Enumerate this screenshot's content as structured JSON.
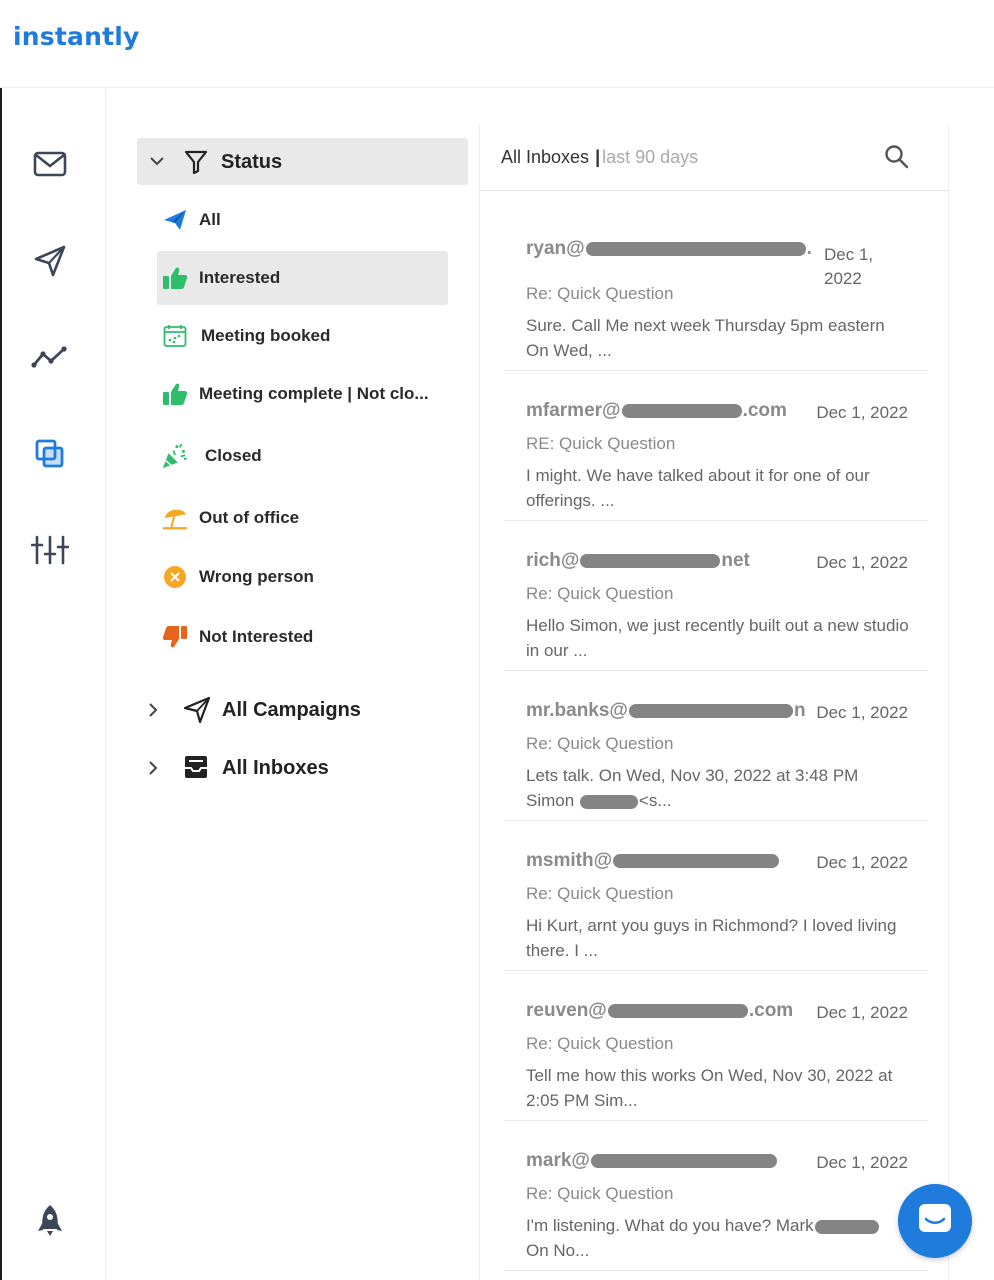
{
  "app": {
    "logo": "instantly",
    "brand_color": "#1f7bdc"
  },
  "rail": {
    "icons": [
      "mail-icon",
      "send-icon",
      "analytics-icon",
      "copy-layers-icon",
      "sliders-icon",
      "rocket-icon"
    ]
  },
  "filters": {
    "status_header": "Status",
    "statuses": [
      {
        "label": "All",
        "icon": "paper-plane-icon"
      },
      {
        "label": "Interested",
        "icon": "thumbs-up-icon",
        "active": true
      },
      {
        "label": "Meeting booked",
        "icon": "calendar-icon"
      },
      {
        "label": "Meeting complete | Not clo...",
        "icon": "thumbs-up-icon"
      },
      {
        "label": "Closed",
        "icon": "party-popper-icon"
      },
      {
        "label": "Out of office",
        "icon": "beach-umbrella-icon"
      },
      {
        "label": "Wrong person",
        "icon": "x-circle-icon"
      },
      {
        "label": "Not Interested",
        "icon": "thumbs-down-icon"
      }
    ],
    "groups": [
      {
        "label": "All Campaigns",
        "icon": "send-icon"
      },
      {
        "label": "All Inboxes",
        "icon": "inbox-icon"
      }
    ]
  },
  "inbox": {
    "header_label": "All Inboxes",
    "header_separator": "|",
    "header_range": "last 90 days",
    "emails": [
      {
        "sender_prefix": "ryan@",
        "sender_suffix": ".",
        "date": "Dec 1, 2022",
        "subject": "Re: Quick Question",
        "preview": "Sure. Call Me next week Thursday 5pm eastern On Wed, ..."
      },
      {
        "sender_prefix": "mfarmer@",
        "sender_suffix": ".com",
        "date": "Dec 1, 2022",
        "subject": "RE: Quick Question",
        "preview": "I might.  We have talked about it for one of our offerings. ..."
      },
      {
        "sender_prefix": "rich@",
        "sender_suffix": "net",
        "date": "Dec 1, 2022",
        "subject": "Re: Quick Question",
        "preview": "Hello Simon, we just recently built out a new studio in our ..."
      },
      {
        "sender_prefix": "mr.banks@",
        "sender_suffix": "n",
        "date": "Dec 1, 2022",
        "subject": "Re: Quick Question",
        "preview_a": "Lets talk.  On Wed, Nov 30, 2022 at 3:48 PM Simon",
        "preview_b": "<s..."
      },
      {
        "sender_prefix": "msmith@",
        "sender_suffix": "",
        "date": "Dec 1, 2022",
        "subject": "Re: Quick Question",
        "preview": "Hi Kurt, arnt you guys in Richmond? I loved living there. I ..."
      },
      {
        "sender_prefix": "reuven@",
        "sender_suffix": ".com",
        "date": "Dec 1, 2022",
        "subject": "Re: Quick Question",
        "preview": "Tell me how this works  On Wed, Nov 30, 2022 at 2:05 PM Sim..."
      },
      {
        "sender_prefix": "mark@",
        "sender_suffix": "",
        "date": "Dec 1, 2022",
        "subject": "Re: Quick Question",
        "preview_a": "I'm listening. What do you have? Mark",
        "preview_b": "On No..."
      }
    ]
  }
}
